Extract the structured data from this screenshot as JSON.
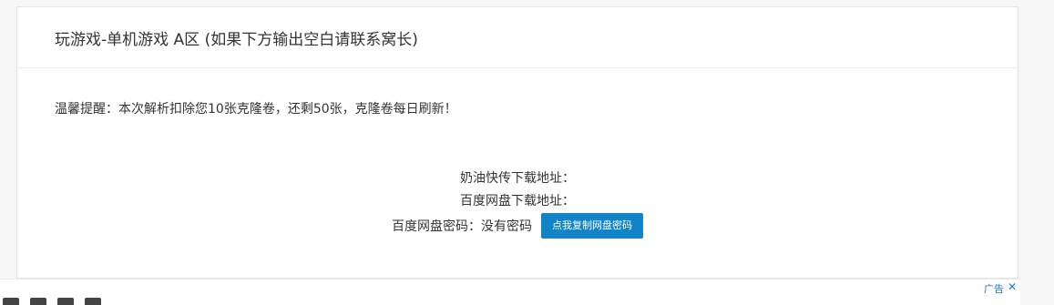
{
  "panel": {
    "title": "玩游戏-单机游戏 A区 (如果下方输出空白请联系窝长)",
    "notice": "温馨提醒：本次解析扣除您10张克隆卷，还剩50张，克隆卷每日刷新！",
    "links": {
      "naiyou_label": "奶油快传下载地址：",
      "baidu_label": "百度网盘下载地址：",
      "pwd_label": "百度网盘密码：没有密码",
      "copy_button": "点我复制网盘密码"
    }
  },
  "ad": {
    "label": "广告",
    "close_icon": "close-icon"
  },
  "colors": {
    "button_bg": "#1184c7",
    "ad_link": "#1a73e8"
  }
}
